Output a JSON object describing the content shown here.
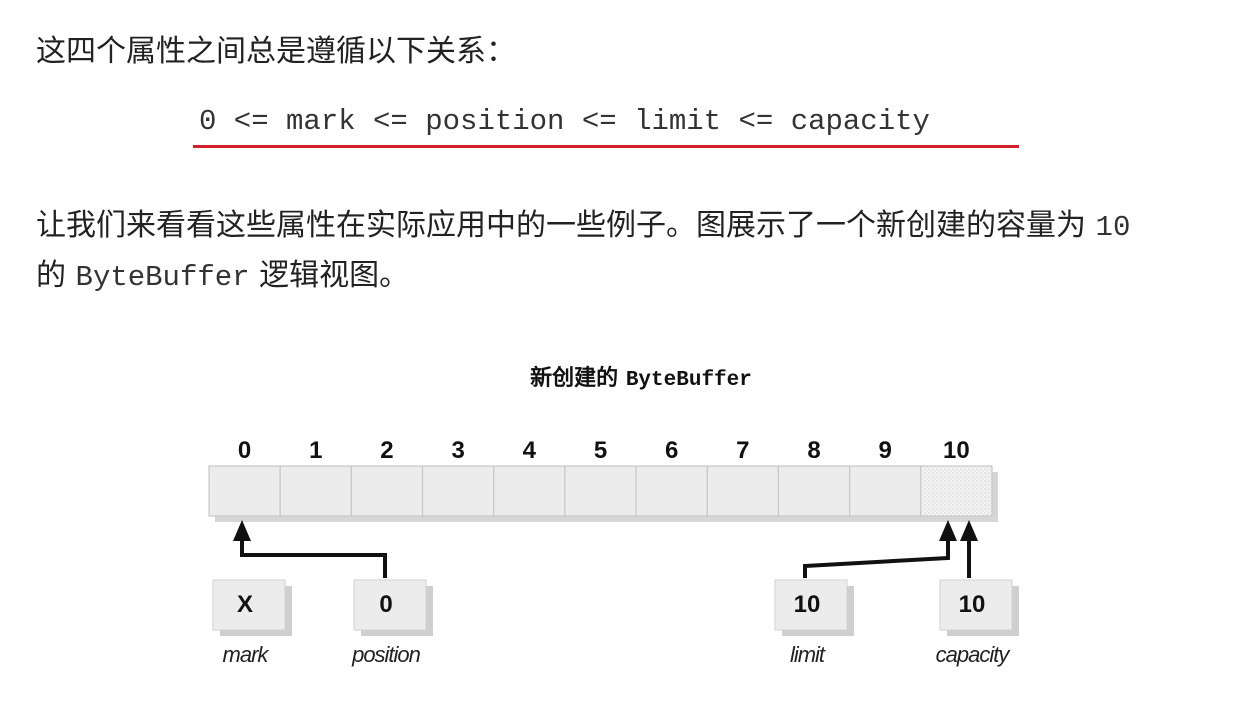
{
  "intro_text": "这四个属性之间总是遵循以下关系：",
  "formula": "0 <= mark <= position <= limit <= capacity",
  "paragraph": {
    "before": "让我们来看看这些属性在实际应用中的一些例子。图展示了一个新创建的容量为",
    "capacity_value": "10",
    "line2_prefix": "的",
    "class_name": "ByteBuffer",
    "after": "逻辑视图。"
  },
  "figure": {
    "title_cn": "新创建的",
    "title_class": "ByteBuffer",
    "indices": [
      "0",
      "1",
      "2",
      "3",
      "4",
      "5",
      "6",
      "7",
      "8",
      "9",
      "10"
    ],
    "boxes": [
      {
        "value": "X",
        "label": "mark"
      },
      {
        "value": "0",
        "label": "position"
      },
      {
        "value": "10",
        "label": "limit"
      },
      {
        "value": "10",
        "label": "capacity"
      }
    ],
    "colors": {
      "accent_underline": "#d0202a",
      "cell_fill": "#ececec",
      "arrow": "#111111"
    }
  }
}
